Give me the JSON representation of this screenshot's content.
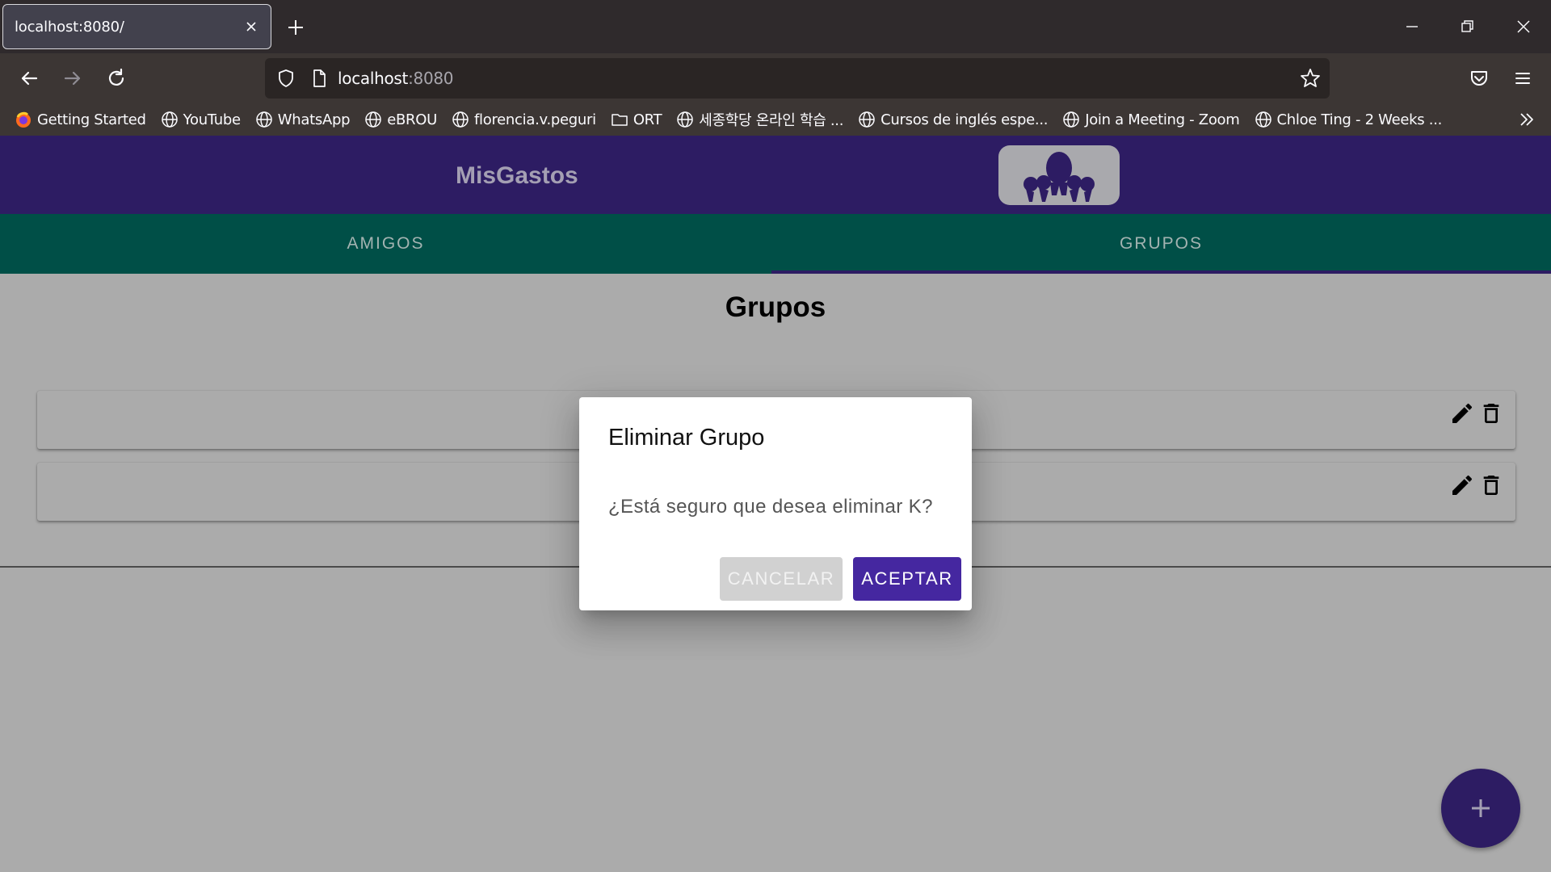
{
  "browser": {
    "tab_title": "localhost:8080/",
    "url_host": "localhost",
    "url_port": ":8080",
    "bookmarks": [
      {
        "label": "Getting Started",
        "icon": "firefox-icon"
      },
      {
        "label": "YouTube",
        "icon": "globe-icon"
      },
      {
        "label": "WhatsApp",
        "icon": "globe-icon"
      },
      {
        "label": "eBROU",
        "icon": "globe-icon"
      },
      {
        "label": "florencia.v.peguri",
        "icon": "globe-icon"
      },
      {
        "label": "ORT",
        "icon": "folder-icon"
      },
      {
        "label": "세종학당 온라인 학습 ...",
        "icon": "globe-icon"
      },
      {
        "label": "Cursos de inglés espe...",
        "icon": "globe-icon"
      },
      {
        "label": "Join a Meeting - Zoom",
        "icon": "globe-icon"
      },
      {
        "label": "Chloe Ting - 2 Weeks ...",
        "icon": "globe-icon"
      }
    ]
  },
  "app": {
    "title": "MisGastos",
    "tabs": [
      {
        "label": "AMIGOS"
      },
      {
        "label": "GRUPOS"
      }
    ],
    "active_tab": "GRUPOS",
    "page_title": "Grupos",
    "colors": {
      "header": "#2d1c63",
      "tabs": "#004f47",
      "accent": "#4527a0"
    }
  },
  "dialog": {
    "title": "Eliminar Grupo",
    "message": "¿Está seguro que desea eliminar K?",
    "cancel_label": "Cancelar",
    "accept_label": "Aceptar"
  }
}
